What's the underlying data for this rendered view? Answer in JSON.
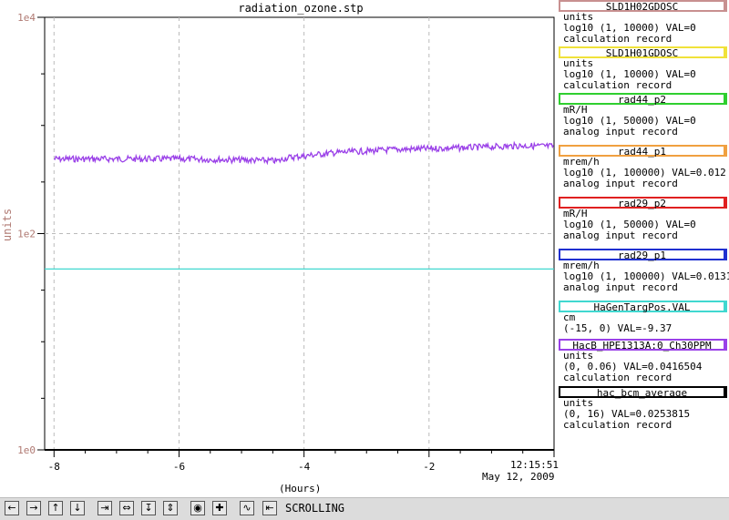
{
  "window": {
    "title": "radiation_ozone.stp"
  },
  "axis": {
    "ylabel": "units",
    "xlabel": "(Hours)",
    "yticks": [
      "1e4",
      "1e2",
      "1e0"
    ],
    "xticks": [
      "-8",
      "-6",
      "-4",
      "-2"
    ],
    "end_time": "12:15:51",
    "end_date": "May 12, 2009",
    "ylabel_color": "#b07a73"
  },
  "legend": [
    {
      "name": "SLD1H02GDOSC",
      "color": "#c89090",
      "lines": [
        "units",
        "log10 (1, 10000)  VAL=0",
        "calculation record"
      ]
    },
    {
      "name": "SLD1H01GDOSC",
      "color": "#f0e23a",
      "lines": [
        "units",
        "log10 (1, 10000) VAL=0",
        "calculation record"
      ]
    },
    {
      "name": "rad44_p2",
      "color": "#2fcf2f",
      "lines": [
        "mR/H",
        "log10 (1, 50000) VAL=0",
        "analog input record"
      ]
    },
    {
      "name": "rad44_p1",
      "color": "#f0a040",
      "lines": [
        "mrem/h",
        "log10 (1, 100000) VAL=0.012",
        "analog input record"
      ]
    },
    {
      "name": "rad29_p2",
      "color": "#e02020",
      "lines": [
        "mR/H",
        "log10 (1, 50000) VAL=0",
        "analog input record"
      ]
    },
    {
      "name": "rad29_p1",
      "color": "#2030d0",
      "lines": [
        "mrem/h",
        "log10 (1, 100000) VAL=0.0131",
        "analog input record"
      ]
    },
    {
      "name": "HaGenTargPos.VAL",
      "color": "#40d8d0",
      "lines": [
        "cm",
        "(-15, 0) VAL=-9.37"
      ]
    },
    {
      "name": "HacB_HPE1313A:0_Ch30PPM",
      "color": "#9a40e8",
      "lines": [
        "units",
        "(0, 0.06) VAL=0.0416504",
        "calculation record"
      ]
    },
    {
      "name": "hac_bcm_average",
      "color": "#000000",
      "lines": [
        "units",
        "(0, 16) VAL=0.0253815",
        "calculation record"
      ]
    }
  ],
  "toolbar": {
    "buttons": [
      "arrow-left-icon",
      "arrow-right-icon",
      "arrow-up-icon",
      "arrow-down-icon",
      "shrink-horizontal-icon",
      "expand-horizontal-icon",
      "shrink-vertical-icon",
      "expand-vertical-icon",
      "record-icon",
      "plus-icon",
      "scroll-icon",
      "mark-icon"
    ],
    "status": "SCROLLING"
  },
  "chart_data": {
    "type": "line",
    "title": "radiation_ozone.stp",
    "xlabel": "(Hours)",
    "ylabel": "units",
    "x_range": [
      -8.15,
      0
    ],
    "yscale": "log",
    "ylim": [
      1,
      10000
    ],
    "series": [
      {
        "name": "HacB_HPE1313A:0_Ch30PPM",
        "color": "#9a40e8",
        "x": [
          -8.0,
          -7.0,
          -6.0,
          -5.0,
          -4.4,
          -4.3,
          -3.5,
          -2.5,
          -1.5,
          -0.5,
          0.0
        ],
        "y": [
          490,
          490,
          490,
          480,
          470,
          500,
          560,
          600,
          620,
          650,
          640
        ]
      },
      {
        "name": "HaGenTargPos.VAL",
        "color": "#40d8d0",
        "x": [
          -8.15,
          0.0
        ],
        "y": [
          47,
          47
        ]
      },
      {
        "name": "hac_bcm_average",
        "color": "#000000",
        "x": [
          -8.15,
          0.0
        ],
        "y": [
          1,
          1
        ]
      }
    ]
  }
}
